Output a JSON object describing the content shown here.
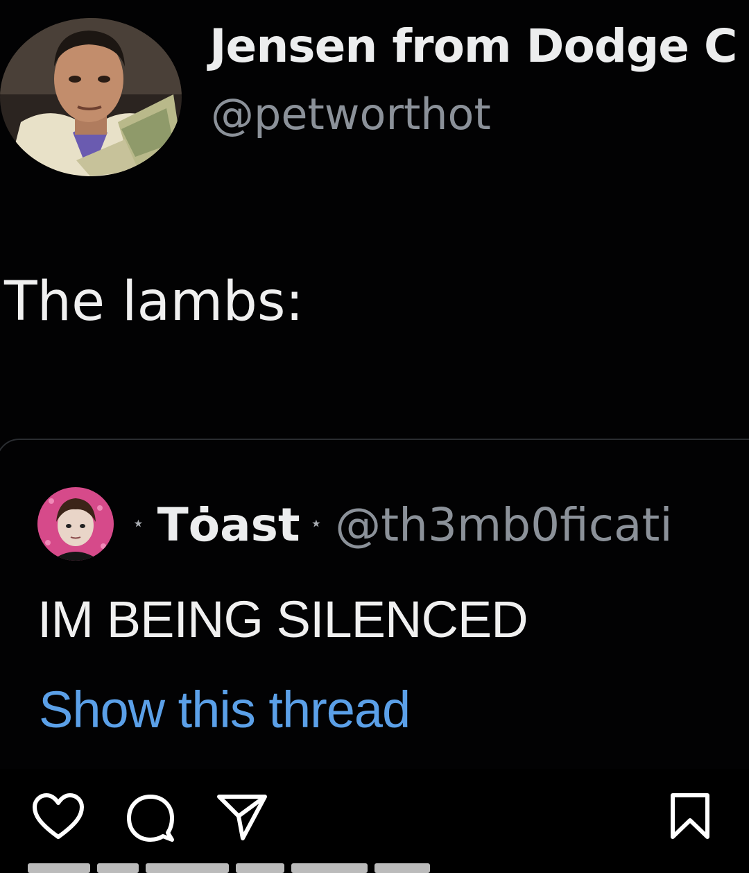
{
  "tweet": {
    "display_name": "Jensen from Dodge C",
    "handle": "@petworthot",
    "text": "The lambs:",
    "avatar": "profile-photo"
  },
  "quoted_tweet": {
    "display_name": "Tȯast",
    "handle": "@th3mb0ficati",
    "separator": "⋆",
    "text": "IM BEING SILENCED",
    "show_thread_label": "Show this thread",
    "avatar": "profile-photo"
  },
  "actions": {
    "icons": [
      "heart-icon",
      "comment-icon",
      "share-icon",
      "bookmark-icon"
    ]
  },
  "colors": {
    "background": "#000000",
    "link": "#5ba0e8",
    "secondary_text": "#8b9199",
    "primary_text": "#ecedee"
  }
}
